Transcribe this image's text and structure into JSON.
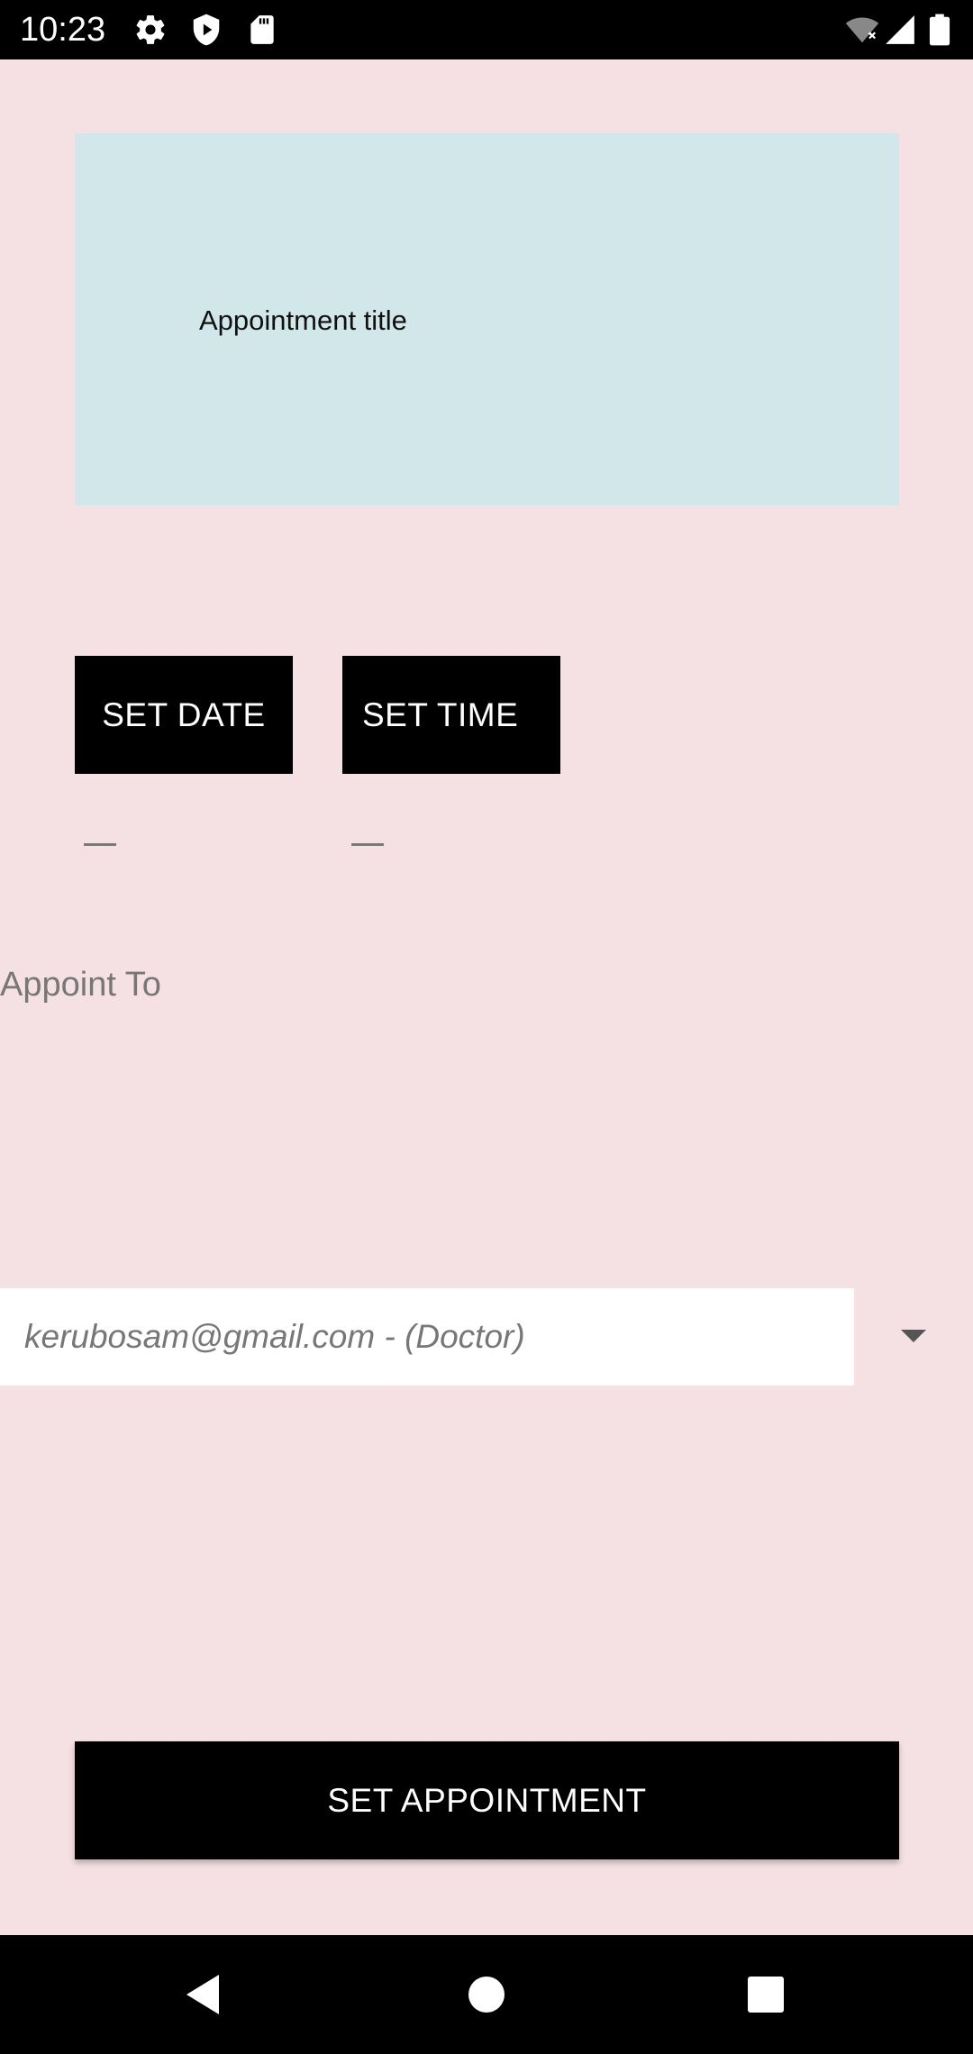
{
  "status_bar": {
    "time": "10:23",
    "left_icons": [
      "settings-icon",
      "shield-play-icon",
      "sd-card-icon"
    ],
    "right_icons": [
      "wifi-off-icon",
      "cell-signal-icon",
      "battery-icon"
    ]
  },
  "form": {
    "title_placeholder": "Appointment title",
    "set_date_label": "SET DATE",
    "set_time_label": "SET TIME",
    "date_value": "—",
    "time_value": "—",
    "appoint_to_label": "Appoint To",
    "appoint_to_selected": "kerubosam@gmail.com - (Doctor)",
    "submit_label": "SET APPOINTMENT"
  },
  "colors": {
    "background": "#f5e1e3",
    "title_card": "#d2e7ea",
    "button": "#000000",
    "button_text": "#ffffff"
  },
  "nav_bar": {
    "icons": [
      "back-icon",
      "home-icon",
      "recents-icon"
    ]
  }
}
